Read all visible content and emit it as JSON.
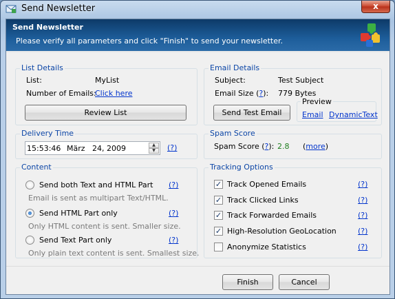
{
  "window": {
    "title": "Send Newsletter",
    "close": "x"
  },
  "header": {
    "title": "Send Newsletter",
    "subtitle": "Please verify all parameters and click \"Finish\" to send your newsletter."
  },
  "list_details": {
    "legend": "List Details",
    "list_label": "List:",
    "list_value": "MyList",
    "emails_label": "Number of Emails:",
    "emails_link": "Click here",
    "review_button": "Review List"
  },
  "email_details": {
    "legend": "Email Details",
    "subject_label": "Subject:",
    "subject_value": "Test Subject",
    "size_label": "Email Size (",
    "size_help": "?",
    "size_label_end": "):",
    "size_value": "779 Bytes",
    "send_test_button": "Send Test Email",
    "preview_legend": "Preview",
    "preview_email": "Email",
    "preview_dynamic": "DynamicText"
  },
  "delivery": {
    "legend": "Delivery Time",
    "time": "15:53:46",
    "month": "März",
    "day_year": "24, 2009",
    "help": "(?)"
  },
  "spam": {
    "legend": "Spam Score",
    "label": "Spam Score (",
    "help": "?",
    "label_end": "):",
    "value": "2.8",
    "more_open": "(",
    "more": "more",
    "more_close": ")"
  },
  "content": {
    "legend": "Content",
    "options": [
      {
        "label": "Send both Text and HTML Part",
        "note": "Email is sent as multipart Text/HTML.",
        "help": "(?)",
        "checked": false
      },
      {
        "label": "Send HTML Part only",
        "note": "Only HTML content is sent. Smaller size.",
        "help": "(?)",
        "checked": true
      },
      {
        "label": "Send Text Part only",
        "note": "Only plain text content is sent. Smallest size.",
        "help": "(?)",
        "checked": false
      }
    ]
  },
  "tracking": {
    "legend": "Tracking Options",
    "options": [
      {
        "label": "Track Opened Emails",
        "help": "(?)",
        "checked": true
      },
      {
        "label": "Track Clicked Links",
        "help": "(?)",
        "checked": true
      },
      {
        "label": "Track Forwarded Emails",
        "help": "(?)",
        "checked": true
      },
      {
        "label": "High-Resolution GeoLocation",
        "help": "(?)",
        "checked": true
      },
      {
        "label": "Anonymize Statistics",
        "help": "(?)",
        "checked": false
      }
    ]
  },
  "footer": {
    "finish": "Finish",
    "cancel": "Cancel"
  },
  "colors": {
    "header_bg": "#1d5d9a",
    "legend_blue": "#0b45a6",
    "link_blue": "#0033cc",
    "spam_green": "#1e7e1e"
  }
}
